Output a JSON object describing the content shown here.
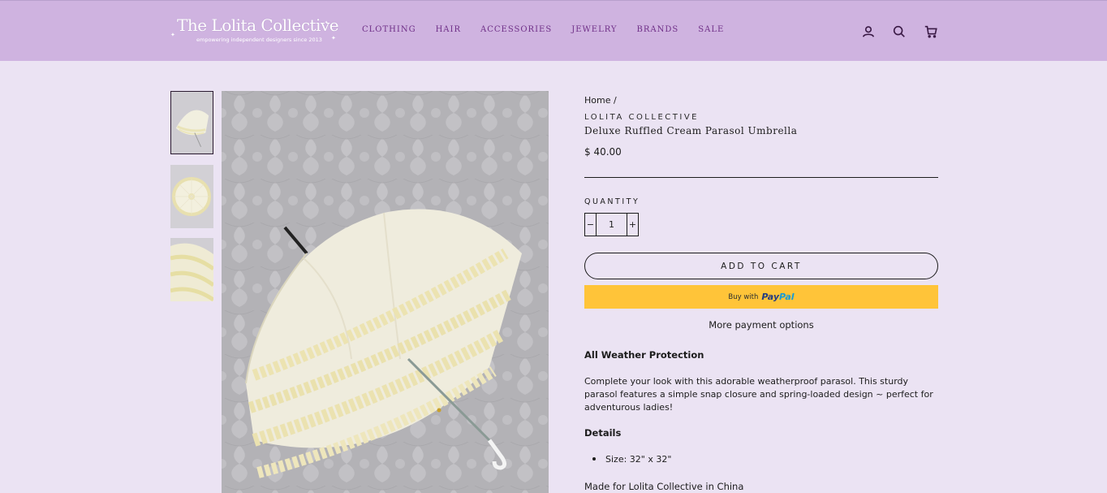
{
  "header": {
    "logo_title": "The Lolita Collective",
    "logo_subtitle": "empowering independent designers since 2013",
    "nav": [
      "Clothing",
      "Hair",
      "Accessories",
      "Jewelry",
      "Brands",
      "Sale"
    ],
    "icons": [
      "account-icon",
      "search-icon",
      "cart-icon"
    ]
  },
  "gallery": {
    "thumbnails": [
      "parasol-side",
      "parasol-top",
      "parasol-ruffles"
    ],
    "active_index": 0
  },
  "product": {
    "breadcrumb": "Home /",
    "vendor": "LOLITA COLLECTIVE",
    "title": "Deluxe Ruffled Cream Parasol Umbrella",
    "price": "$ 40.00",
    "quantity_label": "QUANTITY",
    "quantity_minus": "−",
    "quantity_value": "1",
    "quantity_plus": "+",
    "add_to_cart": "ADD TO CART",
    "paypal_prefix": "Buy with",
    "paypal_brand_1": "Pay",
    "paypal_brand_2": "Pal",
    "more_payment": "More payment options",
    "description_heading": "All Weather Protection",
    "description": "Complete your look with this adorable weatherproof parasol. This sturdy parasol features a simple snap closure and spring-loaded design ~ perfect for adventurous ladies!",
    "details_heading": "Details",
    "details": [
      "Size: 32\" x 32\""
    ],
    "made_in": "Made for Lolita Collective in China"
  },
  "colors": {
    "header_bg": "#cfb3e0",
    "page_bg": "#ebe3f3",
    "nav_text": "#6f2f87",
    "paypal_bg": "#ffc439"
  }
}
